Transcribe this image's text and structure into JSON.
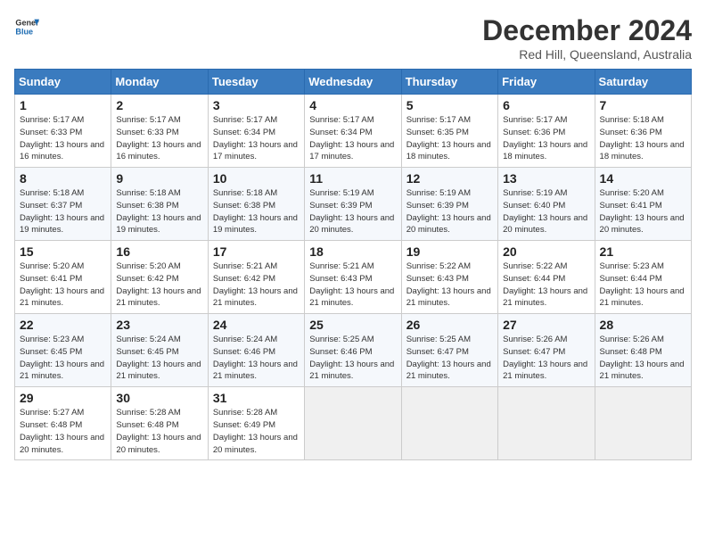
{
  "header": {
    "logo_general": "General",
    "logo_blue": "Blue",
    "month_title": "December 2024",
    "location": "Red Hill, Queensland, Australia"
  },
  "calendar": {
    "days_of_week": [
      "Sunday",
      "Monday",
      "Tuesday",
      "Wednesday",
      "Thursday",
      "Friday",
      "Saturday"
    ],
    "weeks": [
      [
        {
          "day": 1,
          "sunrise": "5:17 AM",
          "sunset": "6:33 PM",
          "daylight": "13 hours and 16 minutes."
        },
        {
          "day": 2,
          "sunrise": "5:17 AM",
          "sunset": "6:33 PM",
          "daylight": "13 hours and 16 minutes."
        },
        {
          "day": 3,
          "sunrise": "5:17 AM",
          "sunset": "6:34 PM",
          "daylight": "13 hours and 17 minutes."
        },
        {
          "day": 4,
          "sunrise": "5:17 AM",
          "sunset": "6:34 PM",
          "daylight": "13 hours and 17 minutes."
        },
        {
          "day": 5,
          "sunrise": "5:17 AM",
          "sunset": "6:35 PM",
          "daylight": "13 hours and 18 minutes."
        },
        {
          "day": 6,
          "sunrise": "5:17 AM",
          "sunset": "6:36 PM",
          "daylight": "13 hours and 18 minutes."
        },
        {
          "day": 7,
          "sunrise": "5:18 AM",
          "sunset": "6:36 PM",
          "daylight": "13 hours and 18 minutes."
        }
      ],
      [
        {
          "day": 8,
          "sunrise": "5:18 AM",
          "sunset": "6:37 PM",
          "daylight": "13 hours and 19 minutes."
        },
        {
          "day": 9,
          "sunrise": "5:18 AM",
          "sunset": "6:38 PM",
          "daylight": "13 hours and 19 minutes."
        },
        {
          "day": 10,
          "sunrise": "5:18 AM",
          "sunset": "6:38 PM",
          "daylight": "13 hours and 19 minutes."
        },
        {
          "day": 11,
          "sunrise": "5:19 AM",
          "sunset": "6:39 PM",
          "daylight": "13 hours and 20 minutes."
        },
        {
          "day": 12,
          "sunrise": "5:19 AM",
          "sunset": "6:39 PM",
          "daylight": "13 hours and 20 minutes."
        },
        {
          "day": 13,
          "sunrise": "5:19 AM",
          "sunset": "6:40 PM",
          "daylight": "13 hours and 20 minutes."
        },
        {
          "day": 14,
          "sunrise": "5:20 AM",
          "sunset": "6:41 PM",
          "daylight": "13 hours and 20 minutes."
        }
      ],
      [
        {
          "day": 15,
          "sunrise": "5:20 AM",
          "sunset": "6:41 PM",
          "daylight": "13 hours and 21 minutes."
        },
        {
          "day": 16,
          "sunrise": "5:20 AM",
          "sunset": "6:42 PM",
          "daylight": "13 hours and 21 minutes."
        },
        {
          "day": 17,
          "sunrise": "5:21 AM",
          "sunset": "6:42 PM",
          "daylight": "13 hours and 21 minutes."
        },
        {
          "day": 18,
          "sunrise": "5:21 AM",
          "sunset": "6:43 PM",
          "daylight": "13 hours and 21 minutes."
        },
        {
          "day": 19,
          "sunrise": "5:22 AM",
          "sunset": "6:43 PM",
          "daylight": "13 hours and 21 minutes."
        },
        {
          "day": 20,
          "sunrise": "5:22 AM",
          "sunset": "6:44 PM",
          "daylight": "13 hours and 21 minutes."
        },
        {
          "day": 21,
          "sunrise": "5:23 AM",
          "sunset": "6:44 PM",
          "daylight": "13 hours and 21 minutes."
        }
      ],
      [
        {
          "day": 22,
          "sunrise": "5:23 AM",
          "sunset": "6:45 PM",
          "daylight": "13 hours and 21 minutes."
        },
        {
          "day": 23,
          "sunrise": "5:24 AM",
          "sunset": "6:45 PM",
          "daylight": "13 hours and 21 minutes."
        },
        {
          "day": 24,
          "sunrise": "5:24 AM",
          "sunset": "6:46 PM",
          "daylight": "13 hours and 21 minutes."
        },
        {
          "day": 25,
          "sunrise": "5:25 AM",
          "sunset": "6:46 PM",
          "daylight": "13 hours and 21 minutes."
        },
        {
          "day": 26,
          "sunrise": "5:25 AM",
          "sunset": "6:47 PM",
          "daylight": "13 hours and 21 minutes."
        },
        {
          "day": 27,
          "sunrise": "5:26 AM",
          "sunset": "6:47 PM",
          "daylight": "13 hours and 21 minutes."
        },
        {
          "day": 28,
          "sunrise": "5:26 AM",
          "sunset": "6:48 PM",
          "daylight": "13 hours and 21 minutes."
        }
      ],
      [
        {
          "day": 29,
          "sunrise": "5:27 AM",
          "sunset": "6:48 PM",
          "daylight": "13 hours and 20 minutes."
        },
        {
          "day": 30,
          "sunrise": "5:28 AM",
          "sunset": "6:48 PM",
          "daylight": "13 hours and 20 minutes."
        },
        {
          "day": 31,
          "sunrise": "5:28 AM",
          "sunset": "6:49 PM",
          "daylight": "13 hours and 20 minutes."
        },
        null,
        null,
        null,
        null
      ]
    ],
    "labels": {
      "sunrise": "Sunrise:",
      "sunset": "Sunset:",
      "daylight": "Daylight:"
    }
  }
}
